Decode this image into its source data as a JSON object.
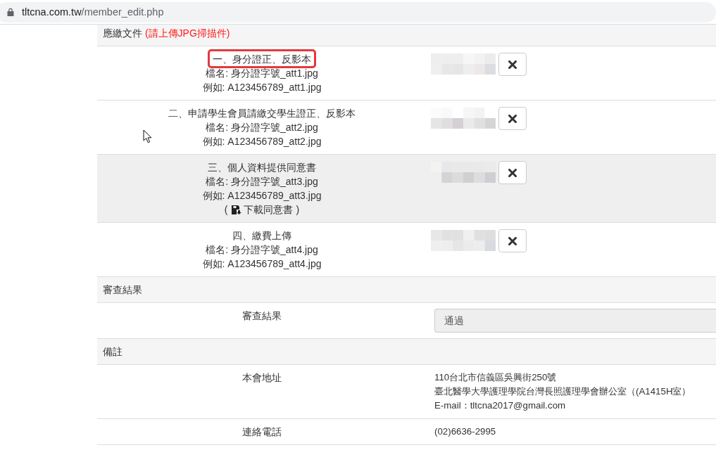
{
  "address_bar": {
    "domain": "tltcna.com.tw",
    "path": "/member_edit.php"
  },
  "sections": [
    {
      "kind": "uploads",
      "title": "應繳文件",
      "note": "(請上傳JPG掃描件)",
      "items": [
        {
          "title": "一、身分證正、反影本",
          "filename": "檔名: 身分證字號_att1.jpg",
          "example": "例如: A123456789_att1.jpg",
          "marked": true,
          "shaded": false
        },
        {
          "title": "二、申請學生會員請繳交學生證正、反影本",
          "filename": "檔名: 身分證字號_att2.jpg",
          "example": "例如: A123456789_att2.jpg",
          "marked": false,
          "shaded": false
        },
        {
          "title": "三、個人資料提供同意書",
          "filename": "檔名: 身分證字號_att3.jpg",
          "example": "例如: A123456789_att3.jpg",
          "download": {
            "open": "(",
            "link": "下載同意書",
            "close": ")"
          },
          "marked": false,
          "shaded": true
        },
        {
          "title": "四、繳費上傳",
          "filename": "檔名: 身分證字號_att4.jpg",
          "example": "例如: A123456789_att4.jpg",
          "marked": false,
          "shaded": false
        }
      ]
    },
    {
      "kind": "select",
      "title": "審查結果",
      "rows": [
        {
          "label": "審查結果",
          "value": "通過",
          "disabled": true
        }
      ]
    },
    {
      "kind": "info",
      "title": "備註",
      "rows": [
        {
          "label": "本會地址",
          "lines": [
            "110台北市信義區吳興街250號",
            "臺北醫學大學護理學院台灣長照護理學會辦公室（(A1415H室）",
            "E-mail：tltcna2017@gmail.com"
          ]
        },
        {
          "label": "連絡電話",
          "lines": [
            "(02)6636-2995"
          ]
        }
      ]
    }
  ]
}
